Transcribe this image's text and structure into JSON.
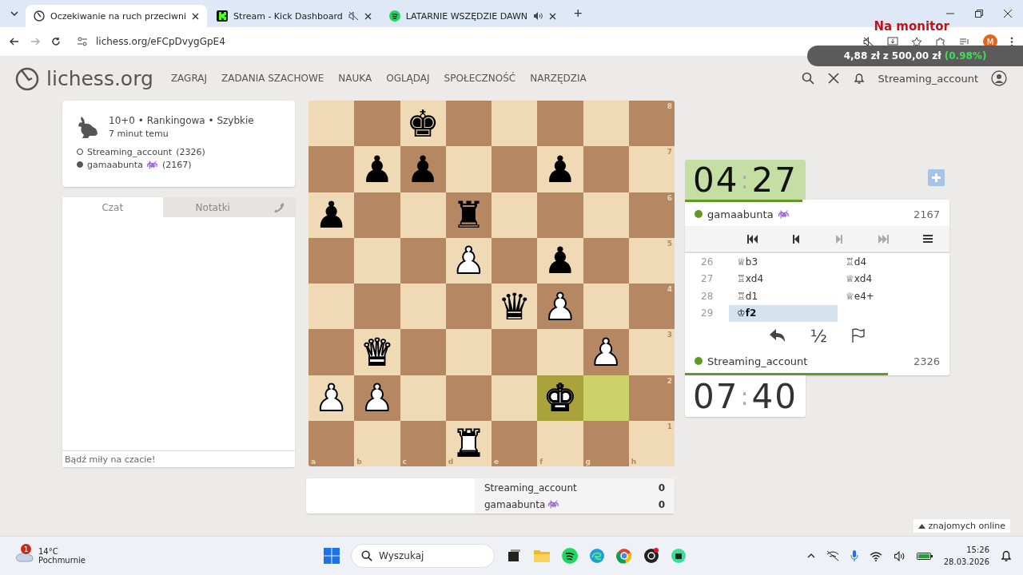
{
  "browser": {
    "tabs": [
      {
        "title": "Oczekiwanie na ruch przeciwni",
        "selected": true,
        "kind": "lichess",
        "muted": false,
        "playing": false
      },
      {
        "title": "Stream - Kick Dashboard",
        "selected": false,
        "kind": "kick",
        "muted": true,
        "playing": false
      },
      {
        "title": "LATARNIE WSZĘDZIE DAWN",
        "selected": false,
        "kind": "spotify",
        "muted": false,
        "playing": true
      }
    ],
    "new_tab": "+",
    "url": "lichess.org/eFCpDvygGpE4",
    "profile_initial": "M"
  },
  "overlay": {
    "label": "Na monitor",
    "amount": "4,88 zł",
    "of": "z",
    "goal": "500,00 zł",
    "percent": "(0.98%)"
  },
  "site": {
    "logo": "lichess.org",
    "nav": [
      "ZAGRAJ",
      "ZADANIA SZACHOWE",
      "NAUKA",
      "OGLĄDAJ",
      "SPOŁECZNOŚĆ",
      "NARZĘDZIA"
    ],
    "user": "Streaming_account"
  },
  "game_info": {
    "title": "10+0 • Rankingowa • Szybkie",
    "time_ago": "7 minut temu",
    "players": [
      {
        "name": "Streaming_account",
        "rating": "(2326)",
        "black": false,
        "flair": false
      },
      {
        "name": "gamaabunta",
        "rating": "(2167)",
        "black": true,
        "flair": true
      }
    ]
  },
  "chat": {
    "tabs": [
      {
        "label": "Czat",
        "selected": true
      },
      {
        "label": "Notatki",
        "selected": false
      }
    ],
    "placeholder": "Bądź miły na czacie!"
  },
  "board": {
    "ranks": [
      "8",
      "7",
      "6",
      "5",
      "4",
      "3",
      "2",
      "1"
    ],
    "files": [
      "a",
      "b",
      "c",
      "d",
      "e",
      "f",
      "g",
      "h"
    ],
    "rows": [
      [
        null,
        null,
        {
          "glyph": "♚",
          "black": true,
          "highlighted": false
        },
        null,
        null,
        null,
        null,
        null
      ],
      [
        null,
        {
          "glyph": "♟",
          "black": true,
          "highlighted": false
        },
        {
          "glyph": "♟",
          "black": true,
          "highlighted": false
        },
        null,
        null,
        {
          "glyph": "♟",
          "black": true,
          "highlighted": false
        },
        null,
        null
      ],
      [
        {
          "glyph": "♟",
          "black": true,
          "highlighted": false
        },
        null,
        null,
        {
          "glyph": "♜",
          "black": true,
          "highlighted": false
        },
        null,
        null,
        null,
        null
      ],
      [
        null,
        null,
        null,
        {
          "glyph": "♟",
          "black": false,
          "highlighted": false
        },
        null,
        {
          "glyph": "♟",
          "black": true,
          "highlighted": false
        },
        null,
        null
      ],
      [
        null,
        null,
        null,
        null,
        {
          "glyph": "♛",
          "black": true,
          "highlighted": false
        },
        {
          "glyph": "♟",
          "black": false,
          "highlighted": false
        },
        null,
        null
      ],
      [
        null,
        {
          "glyph": "♛",
          "black": false,
          "highlighted": false
        },
        null,
        null,
        null,
        null,
        {
          "glyph": "♟",
          "black": false,
          "highlighted": false
        },
        null
      ],
      [
        {
          "glyph": "♟",
          "black": false,
          "highlighted": false
        },
        {
          "glyph": "♟",
          "black": false,
          "highlighted": false
        },
        null,
        null,
        null,
        {
          "glyph": "♚",
          "black": false,
          "highlighted": true
        },
        {
          "highlighted": true
        },
        null
      ],
      [
        null,
        null,
        null,
        {
          "glyph": "♜",
          "black": false,
          "highlighted": false
        },
        null,
        null,
        null,
        null
      ]
    ]
  },
  "scores": [
    {
      "name": "Streaming_account",
      "flair": false,
      "score": "0"
    },
    {
      "name": "gamaabunta",
      "flair": true,
      "score": "0"
    }
  ],
  "top_clock": {
    "minutes": "04",
    "separator": ":",
    "seconds": "27",
    "running": true
  },
  "top_player": {
    "name": "gamaabunta",
    "flair": true,
    "rating": "2167",
    "online": true,
    "level": 0.445
  },
  "moves": [
    {
      "number": "26",
      "white": {
        "san": "♕b3",
        "selected": false
      },
      "black": {
        "san": "♖d4",
        "selected": false
      }
    },
    {
      "number": "27",
      "white": {
        "san": "♖xd4",
        "selected": false
      },
      "black": {
        "san": "♕xd4",
        "selected": false
      }
    },
    {
      "number": "28",
      "white": {
        "san": "♖d1",
        "selected": false
      },
      "black": {
        "san": "♕e4+",
        "selected": false
      }
    },
    {
      "number": "29",
      "white": {
        "san": "♔f2",
        "selected": true
      }
    }
  ],
  "draw_offer": "½",
  "bottom_player": {
    "name": "Streaming_account",
    "flair": false,
    "rating": "2326",
    "online": true,
    "level": 0.767
  },
  "bottom_clock": {
    "minutes": "07",
    "separator": ":",
    "seconds": "40",
    "running": false
  },
  "friends": "znajomych online",
  "taskbar": {
    "weather_badge": "1",
    "temperature": "14°C",
    "weather": "Pochmurnie",
    "search_placeholder": "Wyszukaj",
    "time": "15:26",
    "date": "28.03.2026"
  }
}
